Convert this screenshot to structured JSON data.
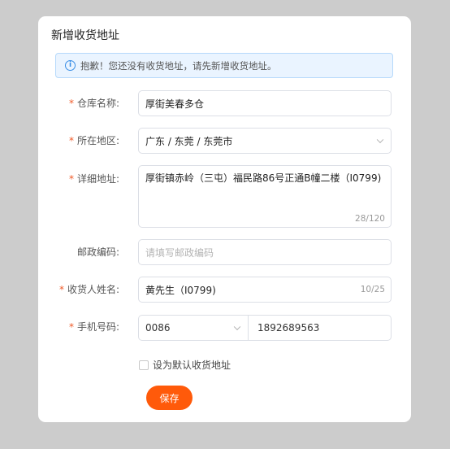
{
  "dialog": {
    "title": "新增收货地址",
    "alert_text": "抱歉！您还没有收货地址，请先新增收货地址。",
    "alert_icon": "info-icon"
  },
  "form": {
    "required_mark": "*",
    "warehouse": {
      "label": "仓库名称:",
      "value": "厚街美春多仓"
    },
    "region": {
      "label": "所在地区:",
      "value": "广东 / 东莞 / 东莞市",
      "icon": "chevron-down-icon"
    },
    "address": {
      "label": "详细地址:",
      "value": "厚街镇赤岭（三屯）福民路86号正通B幢二楼（I0799)",
      "counter": "28/120"
    },
    "postal": {
      "label": "邮政编码:",
      "placeholder": "请填写邮政编码"
    },
    "recipient": {
      "label": "收货人姓名:",
      "value": "黄先生（I0799)",
      "counter": "10/25"
    },
    "phone": {
      "label": "手机号码:",
      "prefix": "0086",
      "number": "1892689563",
      "icon": "chevron-down-icon"
    },
    "default_checkbox": {
      "label": "设为默认收货地址",
      "checked": false
    },
    "save_label": "保存"
  },
  "colors": {
    "accent": "#ff5a0a",
    "required": "#f05a28",
    "alert_bg": "#eaf4ff",
    "alert_border": "#b6d9fb",
    "info": "#3a8ee6"
  }
}
